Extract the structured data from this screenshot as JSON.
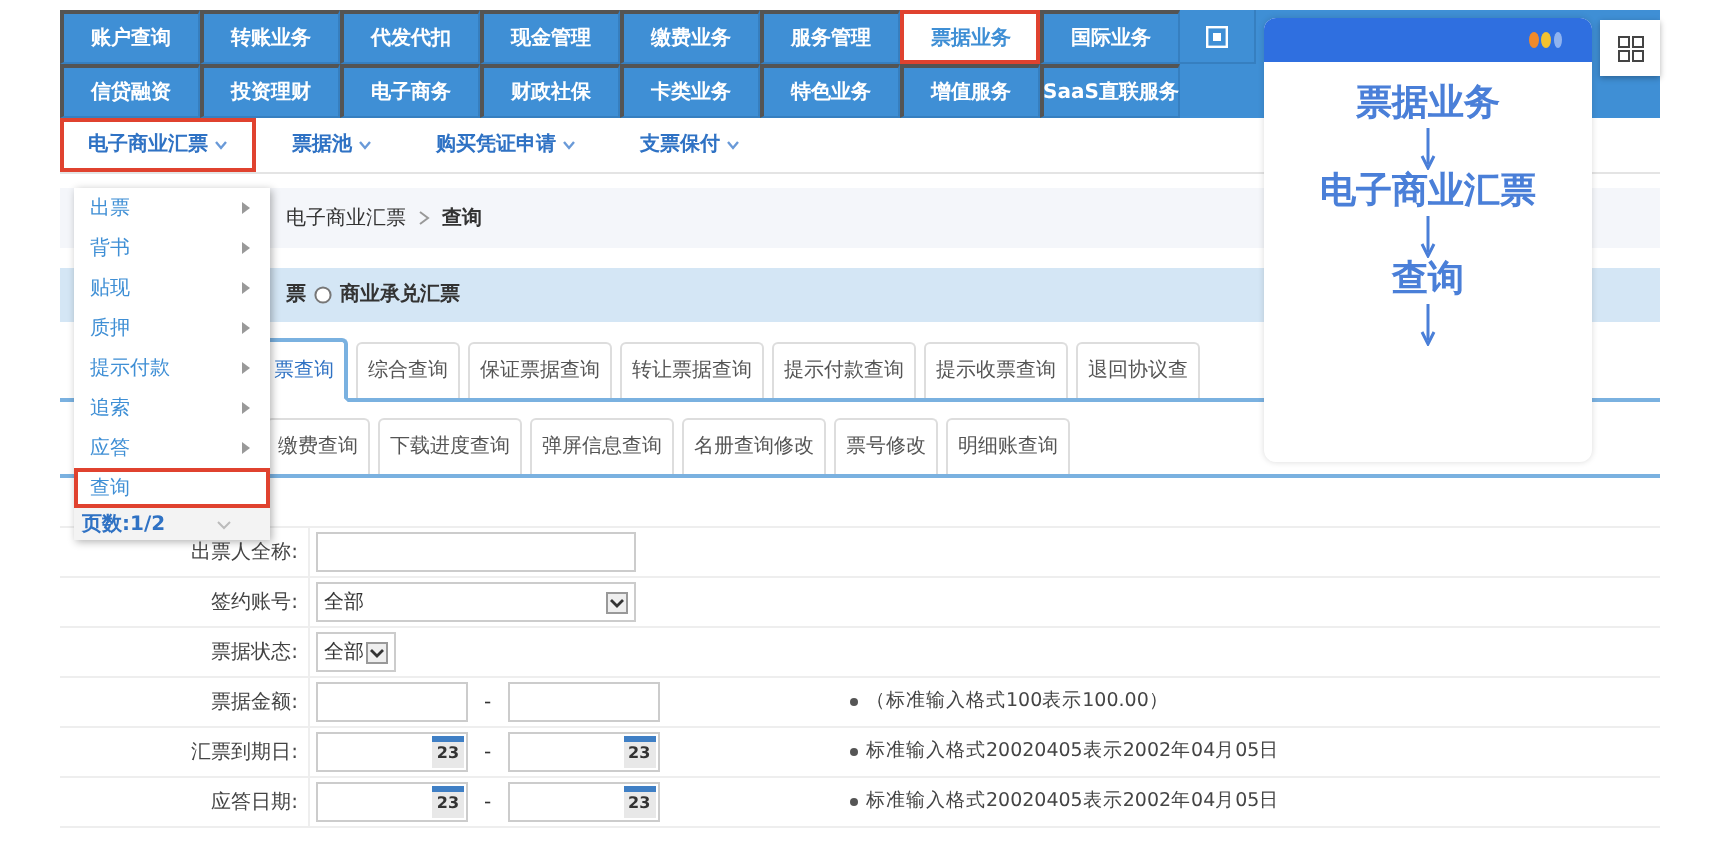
{
  "top_nav": {
    "rows": [
      {
        "items": [
          {
            "label": "账户查询",
            "highlighted": false
          },
          {
            "label": "转账业务",
            "highlighted": false
          },
          {
            "label": "代发代扣",
            "highlighted": false
          },
          {
            "label": "现金管理",
            "highlighted": false
          },
          {
            "label": "缴费业务",
            "highlighted": false
          },
          {
            "label": "服务管理",
            "highlighted": false
          },
          {
            "label": "票据业务",
            "highlighted": true
          },
          {
            "label": "国际业务",
            "highlighted": false
          }
        ]
      },
      {
        "items": [
          {
            "label": "信贷融资",
            "highlighted": false
          },
          {
            "label": "投资理财",
            "highlighted": false
          },
          {
            "label": "电子商务",
            "highlighted": false
          },
          {
            "label": "财政社保",
            "highlighted": false
          },
          {
            "label": "卡类业务",
            "highlighted": false
          },
          {
            "label": "特色业务",
            "highlighted": false
          },
          {
            "label": "增值服务",
            "highlighted": false
          },
          {
            "label": "SaaS直联服务",
            "highlighted": false
          }
        ]
      }
    ]
  },
  "sub_nav": [
    {
      "label": "电子商业汇票",
      "highlighted": true
    },
    {
      "label": "票据池",
      "highlighted": false
    },
    {
      "label": "购买凭证申请",
      "highlighted": false
    },
    {
      "label": "支票保付",
      "highlighted": false
    }
  ],
  "dropdown_menu": {
    "items": [
      {
        "label": "出票",
        "has_submenu": true,
        "highlighted": false
      },
      {
        "label": "背书",
        "has_submenu": true,
        "highlighted": false
      },
      {
        "label": "贴现",
        "has_submenu": true,
        "highlighted": false
      },
      {
        "label": "质押",
        "has_submenu": true,
        "highlighted": false
      },
      {
        "label": "提示付款",
        "has_submenu": true,
        "highlighted": false
      },
      {
        "label": "追索",
        "has_submenu": true,
        "highlighted": false
      },
      {
        "label": "应答",
        "has_submenu": true,
        "highlighted": false
      },
      {
        "label": "查询",
        "has_submenu": false,
        "highlighted": true
      }
    ],
    "page_info": "页数:1/2"
  },
  "breadcrumb": [
    "电子商业汇票",
    "查询"
  ],
  "bill_type": {
    "visible_text": "票",
    "options": [
      {
        "label": "商业承兑汇票",
        "selected": false
      }
    ]
  },
  "tabs_row_1": [
    {
      "label": "票查询",
      "selected": true
    },
    {
      "label": "综合查询",
      "selected": false
    },
    {
      "label": "保证票据查询",
      "selected": false
    },
    {
      "label": "转让票据查询",
      "selected": false
    },
    {
      "label": "提示付款查询",
      "selected": false
    },
    {
      "label": "提示收票查询",
      "selected": false
    },
    {
      "label": "退回协议查",
      "selected": false
    }
  ],
  "tabs_row_2": [
    {
      "label": "缴费查询",
      "selected": false
    },
    {
      "label": "下载进度查询",
      "selected": false
    },
    {
      "label": "弹屏信息查询",
      "selected": false
    },
    {
      "label": "名册查询修改",
      "selected": false
    },
    {
      "label": "票号修改",
      "selected": false
    },
    {
      "label": "明细账查询",
      "selected": false
    }
  ],
  "form": [
    {
      "label": "出票人全称:",
      "kind": "text"
    },
    {
      "label": "签约账号:",
      "kind": "select",
      "value": "全部"
    },
    {
      "label": "票据状态:",
      "kind": "combo",
      "value": "全部"
    },
    {
      "label": "票据金额:",
      "kind": "range",
      "separator": "-",
      "hint": "（标准输入格式100表示100.00）"
    },
    {
      "label": "汇票到期日:",
      "kind": "daterange",
      "separator": "-",
      "calendar_days": [
        "23",
        "23"
      ],
      "hint": "标准输入格式20020405表示2002年04月05日"
    },
    {
      "label": "应答日期:",
      "kind": "daterange",
      "separator": "-",
      "calendar_days": [
        "23",
        "23"
      ],
      "hint": "标准输入格式20020405表示2002年04月05日"
    }
  ],
  "annotation": {
    "steps": [
      "票据业务",
      "电子商业汇票",
      "查询"
    ]
  }
}
